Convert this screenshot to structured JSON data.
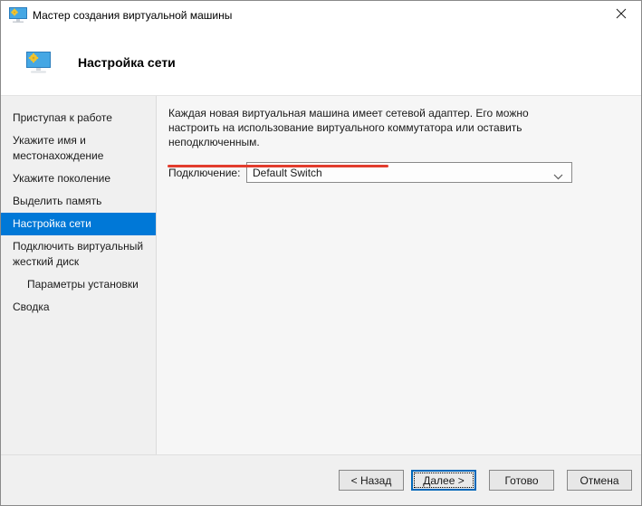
{
  "titlebar": {
    "title": "Мастер создания виртуальной машины"
  },
  "header": {
    "title": "Настройка сети"
  },
  "sidebar": {
    "items": [
      {
        "label": "Приступая к работе",
        "selected": false,
        "indented": false
      },
      {
        "label": "Укажите имя и местонахождение",
        "selected": false,
        "indented": false
      },
      {
        "label": "Укажите поколение",
        "selected": false,
        "indented": false
      },
      {
        "label": "Выделить память",
        "selected": false,
        "indented": false
      },
      {
        "label": "Настройка сети",
        "selected": true,
        "indented": false
      },
      {
        "label": "Подключить виртуальный жесткий диск",
        "selected": false,
        "indented": false
      },
      {
        "label": "Параметры установки",
        "selected": false,
        "indented": true
      },
      {
        "label": "Сводка",
        "selected": false,
        "indented": false
      }
    ]
  },
  "content": {
    "description": "Каждая новая виртуальная машина имеет сетевой адаптер. Его можно настроить на использование виртуального коммутатора или оставить неподключенным.",
    "connection": {
      "label": "Подключение:",
      "value": "Default Switch"
    }
  },
  "annotation": {
    "type": "red-underline",
    "color": "#e23c2d"
  },
  "footer": {
    "buttons": [
      {
        "label": "< Назад",
        "focused": false
      },
      {
        "label": "Далее >",
        "focused": true
      },
      {
        "label": "Готово",
        "focused": false
      },
      {
        "label": "Отмена",
        "focused": false
      }
    ]
  },
  "colors": {
    "selection_blue": "#0078d7",
    "focus_border_blue": "#0067b8",
    "annotation_red": "#e23c2d"
  }
}
